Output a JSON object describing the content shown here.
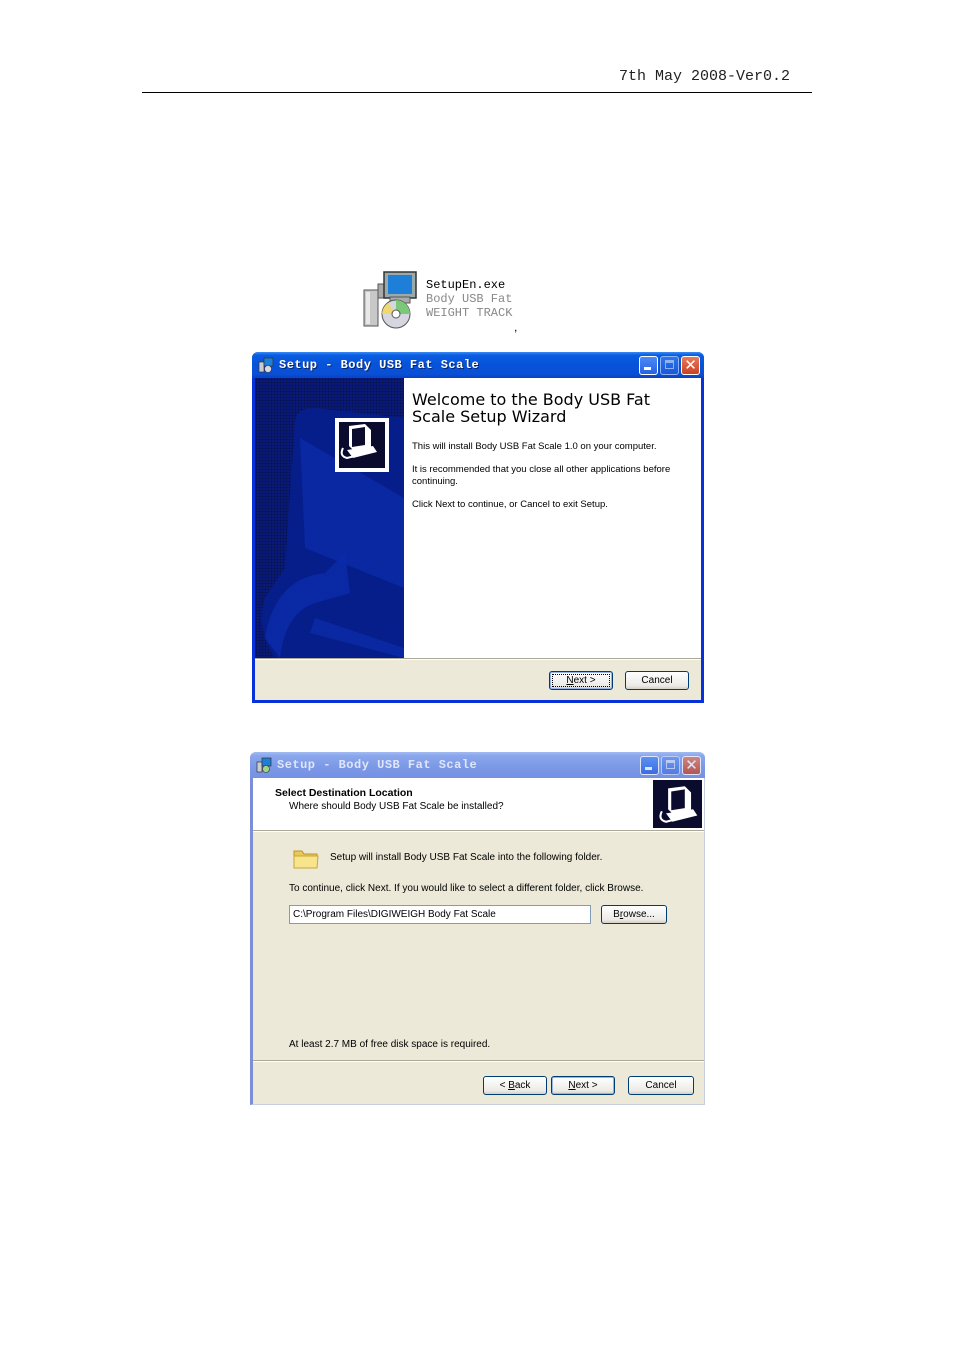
{
  "document": {
    "header_text": "7th May 2008-Ver0.2"
  },
  "exe_file": {
    "icon": "setup-installer-icon",
    "name": "SetupEn.exe",
    "description_line1": "Body USB Fat",
    "description_line2": "WEIGHT TRACK",
    "trailing_punct": ","
  },
  "window1": {
    "title": "Setup - Body USB Fat Scale",
    "title_icon": "setup-app-icon",
    "controls": {
      "minimize": "minimize",
      "maximize": "maximize",
      "close": "close"
    },
    "heading": "Welcome to the Body USB Fat Scale Setup Wizard",
    "paragraph1": "This will install Body USB Fat Scale 1.0 on your computer.",
    "paragraph2": "It is recommended that you close all other applications before continuing.",
    "paragraph3": "Click Next to continue, or Cancel to exit Setup.",
    "buttons": {
      "next_mnemonic": "N",
      "next_rest": "ext >",
      "cancel": "Cancel"
    }
  },
  "window2": {
    "title": "Setup - Body USB Fat Scale",
    "title_icon": "setup-app-icon",
    "header_title": "Select Destination Location",
    "header_subtitle": "Where should Body USB Fat Scale be installed?",
    "folder_message": "Setup will install Body USB Fat Scale into the following folder.",
    "instruction": "To continue, click Next. If you would like to select a different folder, click Browse.",
    "install_path": "C:\\Program Files\\DIGIWEIGH Body Fat Scale",
    "browse_pre": "B",
    "browse_mnemonic": "r",
    "browse_rest": "owse...",
    "disk_space": "At least 2.7 MB of free disk space is required.",
    "buttons": {
      "back_pre": "< ",
      "back_mnemonic": "B",
      "back_rest": "ack",
      "next_mnemonic": "N",
      "next_rest": "ext >",
      "cancel": "Cancel"
    }
  }
}
